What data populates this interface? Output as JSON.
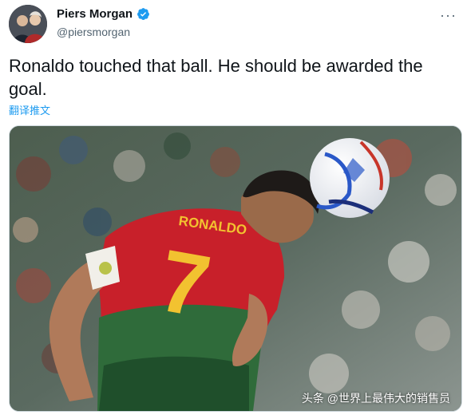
{
  "author": {
    "display_name": "Piers Morgan",
    "handle": "@piersmorgan",
    "verified": true,
    "verified_color": "#1d9bf0"
  },
  "header": {
    "more_icon": "more-horizontal-icon",
    "more_label": "···"
  },
  "tweet": {
    "text": "Ronaldo touched that ball. He should be awarded the goal.",
    "translate_label": "翻译推文"
  },
  "media": {
    "jersey_name": "RONALDO",
    "jersey_number": "7",
    "watermark": "头条 @世界上最伟大的销售员"
  },
  "colors": {
    "link": "#1d9bf0",
    "jersey_red": "#c8202a",
    "jersey_green": "#2f6b3a",
    "number_yellow": "#f2c230"
  }
}
